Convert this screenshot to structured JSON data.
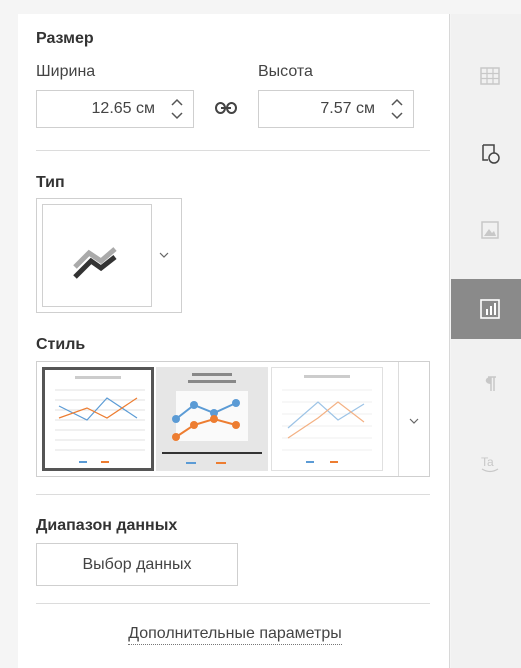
{
  "size": {
    "title": "Размер",
    "width_label": "Ширина",
    "height_label": "Высота",
    "width_value": "12.65 см",
    "height_value": "7.57 см"
  },
  "type": {
    "title": "Тип"
  },
  "style": {
    "title": "Стиль"
  },
  "data_range": {
    "title": "Диапазон данных",
    "select_button": "Выбор данных"
  },
  "advanced_link": "Дополнительные параметры",
  "sidebar": {
    "tabs": [
      {
        "icon": "table-icon",
        "active": false
      },
      {
        "icon": "shape-icon",
        "active": false
      },
      {
        "icon": "image-icon",
        "active": false
      },
      {
        "icon": "chart-icon",
        "active": true
      },
      {
        "icon": "paragraph-icon",
        "active": false
      },
      {
        "icon": "text-art-icon",
        "active": false
      }
    ]
  },
  "colors": {
    "active_tab": "#8a8a8a",
    "selected_border": "#555555",
    "series_blue": "#5b9bd5",
    "series_orange": "#ed7d31"
  }
}
